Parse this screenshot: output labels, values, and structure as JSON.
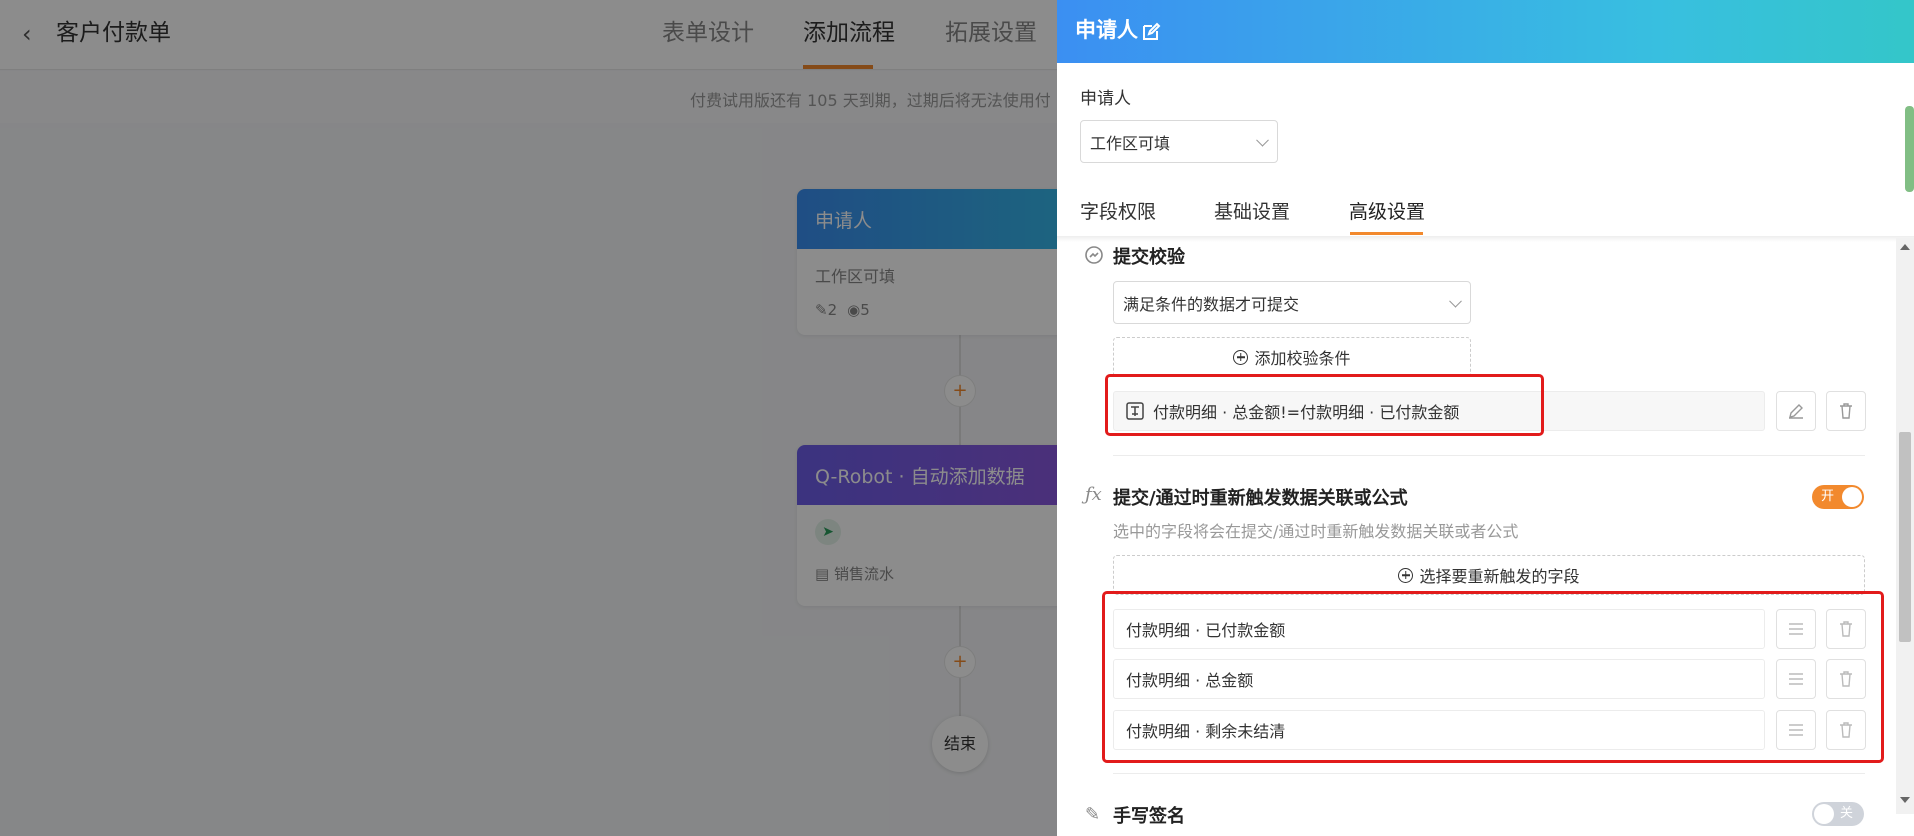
{
  "background": {
    "page_title": "客户付款单",
    "tabs": [
      "表单设计",
      "添加流程",
      "拓展设置"
    ],
    "active_tab_index": 1,
    "trial_notice": "付费试用版还有 105 天到期，过期后将无法使用付",
    "nodes": {
      "applicant": {
        "title": "申请人",
        "subtitle": "工作区可填",
        "edit_count": "2",
        "view_count": "5"
      },
      "robot": {
        "title": "Q-Robot · 自动添加数据",
        "table": "销售流水"
      }
    },
    "end_label": "结束",
    "plus_symbol": "+"
  },
  "drawer": {
    "title": "申请人",
    "applicant_label": "申请人",
    "applicant_select": "工作区可填",
    "tabs": [
      "字段权限",
      "基础设置",
      "高级设置"
    ],
    "active_tab_index": 2,
    "submit_check": {
      "title": "提交校验",
      "mode_select": "满足条件的数据才可提交",
      "add_button": "添加校验条件",
      "conditions": [
        "付款明细 · 总金额!=付款明细 · 已付款金额"
      ]
    },
    "retrigger": {
      "title": "提交/通过时重新触发数据关联或公式",
      "description": "选中的字段将会在提交/通过时重新触发数据关联或者公式",
      "toggle_label": "开",
      "toggle_on": true,
      "add_button": "选择要重新触发的字段",
      "fields": [
        "付款明细 · 已付款金额",
        "付款明细 · 总金额",
        "付款明细 · 剩余未结清"
      ]
    },
    "signature": {
      "title": "手写签名",
      "toggle_label": "关",
      "toggle_on": false
    }
  },
  "colors": {
    "accent": "#f2892d",
    "header_blue": "#3b8ff2",
    "header_teal": "#34c6c9",
    "highlight_red": "#e21b1b",
    "robot_purple": "#6c5ee8"
  }
}
